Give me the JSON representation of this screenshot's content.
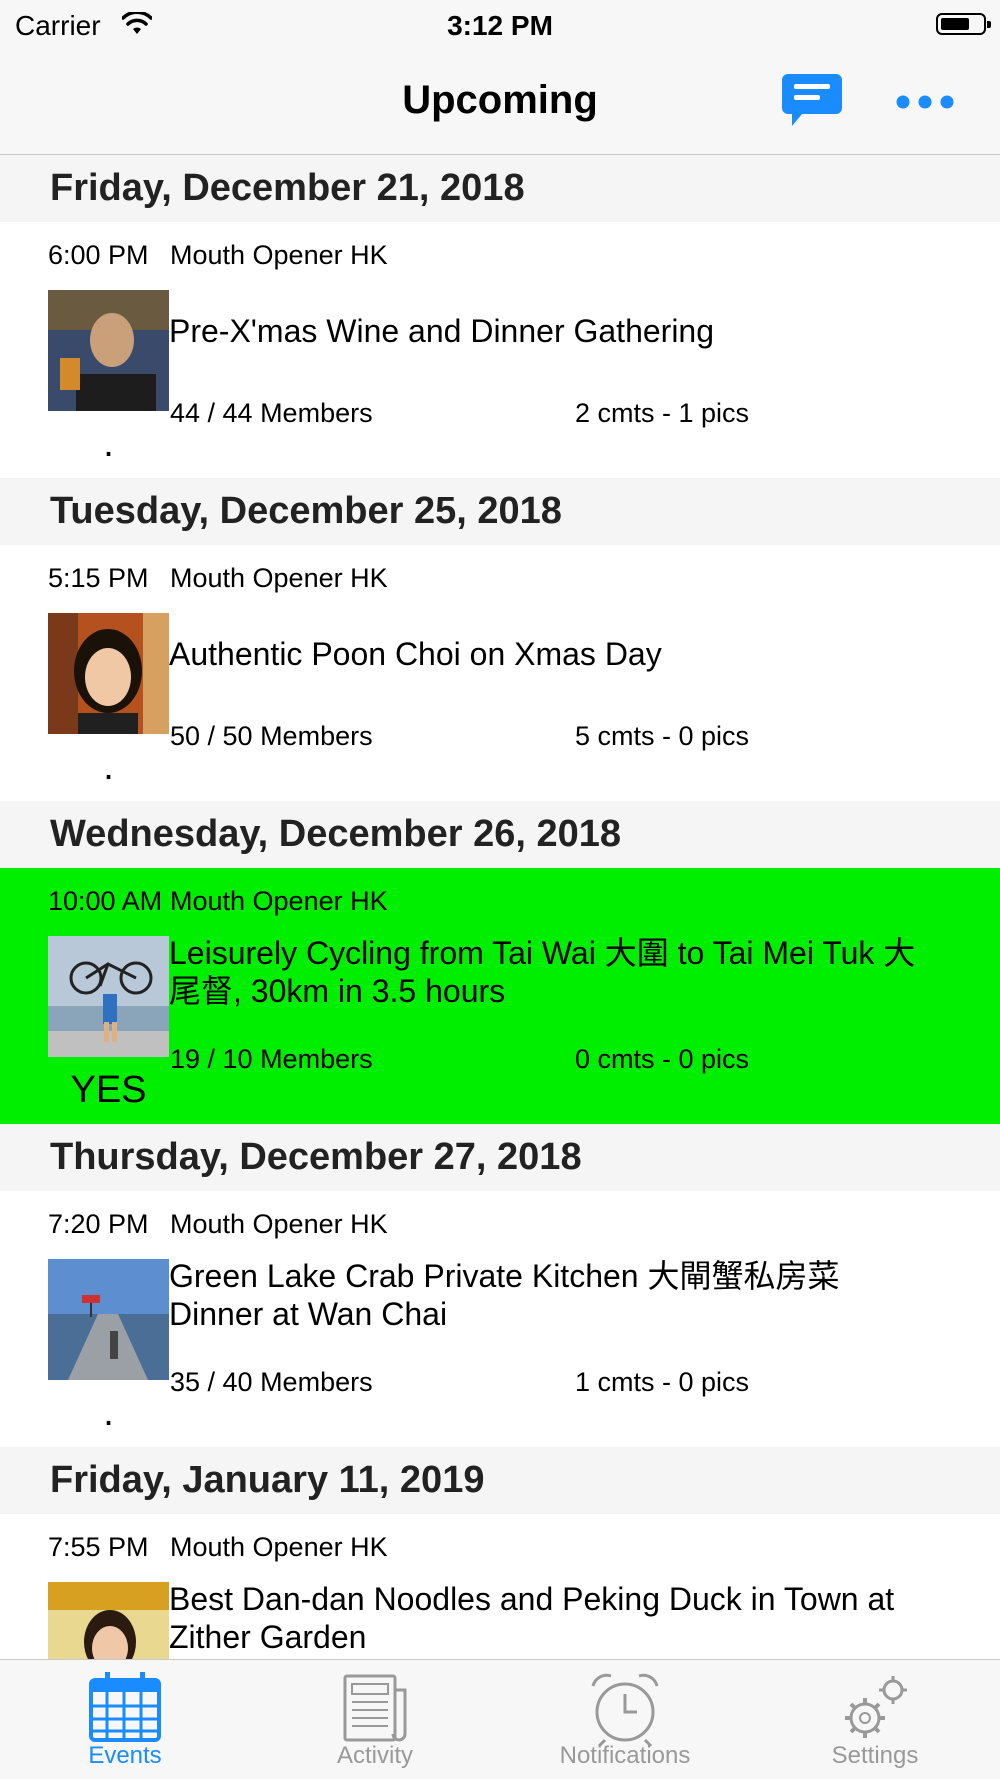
{
  "status_bar": {
    "carrier": "Carrier",
    "time": "3:12 PM"
  },
  "nav": {
    "title": "Upcoming",
    "chat_icon": "chat-bubble-icon",
    "more_icon": "ellipsis-icon"
  },
  "sections": [
    {
      "date": "Friday, December 21, 2018",
      "event": {
        "time": "6:00 PM",
        "group": "Mouth Opener HK",
        "title": "Pre-X'mas Wine and Dinner Gathering",
        "members": "44 / 44 Members",
        "counts": "2 cmts - 1 pics",
        "rsvp": "."
      }
    },
    {
      "date": "Tuesday, December 25, 2018",
      "event": {
        "time": "5:15 PM",
        "group": "Mouth Opener HK",
        "title": "Authentic Poon Choi on Xmas Day",
        "members": "50 / 50 Members",
        "counts": "5 cmts - 0 pics",
        "rsvp": "."
      }
    },
    {
      "date": "Wednesday, December 26, 2018",
      "event": {
        "time": "10:00 AM",
        "group": "Mouth Opener HK",
        "title": "Leisurely Cycling from Tai Wai 大圍 to Tai Mei Tuk 大尾督, 30km in 3.5 hours",
        "members": "19 / 10 Members",
        "counts": "0 cmts - 0 pics",
        "rsvp": "YES"
      }
    },
    {
      "date": "Thursday, December 27, 2018",
      "event": {
        "time": "7:20 PM",
        "group": "Mouth Opener HK",
        "title": "Green Lake Crab Private Kitchen 大閘蟹私房菜 Dinner at Wan Chai",
        "members": "35 / 40 Members",
        "counts": "1 cmts - 0 pics",
        "rsvp": "."
      }
    },
    {
      "date": "Friday, January 11, 2019",
      "event": {
        "time": "7:55 PM",
        "group": "Mouth Opener HK",
        "title": "Best Dan-dan Noodles and Peking Duck in Town at Zither Garden",
        "members": "",
        "counts": "",
        "rsvp": ""
      }
    }
  ],
  "tabs": [
    {
      "label": "Events",
      "icon": "calendar-icon",
      "active": true
    },
    {
      "label": "Activity",
      "icon": "newspaper-icon",
      "active": false
    },
    {
      "label": "Notifications",
      "icon": "alarm-clock-icon",
      "active": false
    },
    {
      "label": "Settings",
      "icon": "gears-icon",
      "active": false
    }
  ],
  "colors": {
    "accent": "#1a8cff",
    "highlight_row": "#00ee00",
    "section_bg": "#f5f5f5",
    "tab_inactive": "#999999"
  }
}
